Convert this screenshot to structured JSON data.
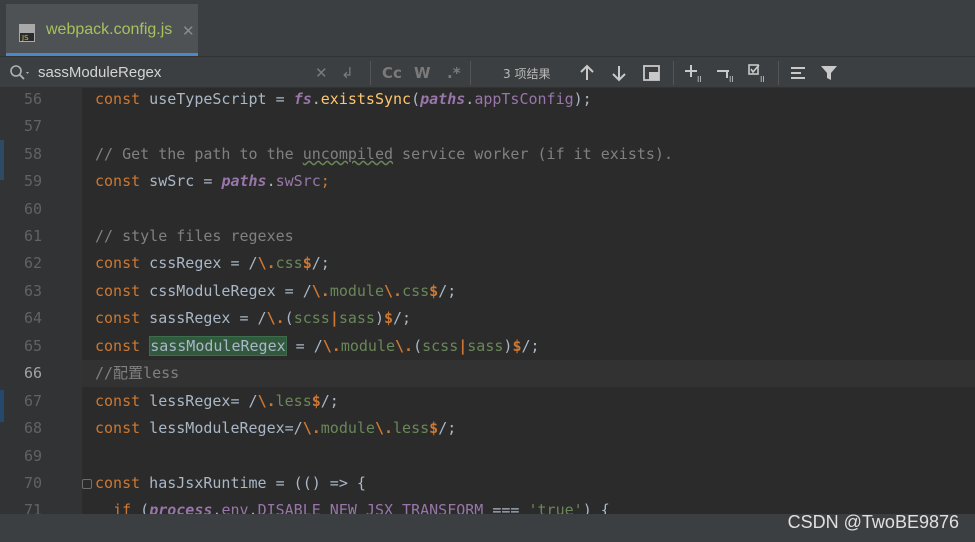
{
  "tab": {
    "filename": "webpack.config.js",
    "icon": "js-file-icon",
    "badge": "JS"
  },
  "search": {
    "value": "sassModuleRegex",
    "match_case_label": "Cc",
    "words_label": "W",
    "regex_label": ".*",
    "match_count": "3 项结果"
  },
  "editor": {
    "lines": [
      {
        "n": "56"
      },
      {
        "n": "57"
      },
      {
        "n": "58"
      },
      {
        "n": "59"
      },
      {
        "n": "60"
      },
      {
        "n": "61"
      },
      {
        "n": "62"
      },
      {
        "n": "63"
      },
      {
        "n": "64"
      },
      {
        "n": "65"
      },
      {
        "n": "66",
        "current": true
      },
      {
        "n": "67"
      },
      {
        "n": "68"
      },
      {
        "n": "69"
      },
      {
        "n": "70"
      },
      {
        "n": "71"
      }
    ],
    "code": {
      "l56": {
        "kw": "const",
        "name": " useTypeScript = ",
        "obj": "fs",
        "dot": ".",
        "fn": "existsSync",
        "open": "(",
        "obj2": "paths",
        "dot2": ".",
        "prop": "appTsConfig",
        "close": ");"
      },
      "l58": {
        "c1": "// Get the path to the ",
        "c2": "uncompiled",
        "c3": " service worker (if it exists)."
      },
      "l59": {
        "kw": "const",
        "name": " swSrc = ",
        "obj": "paths",
        "dot": ".",
        "prop": "swSrc",
        "end": ";"
      },
      "l61": {
        "comment": "// style files regexes"
      },
      "l62": {
        "kw": "const",
        "name": " cssRegex = /",
        "e1": "\\.",
        "r1": "css",
        "e2": "$",
        "end": "/;"
      },
      "l63": {
        "kw": "const",
        "name": " cssModuleRegex = /",
        "e1": "\\.",
        "r1": "module",
        "e2": "\\.",
        "r2": "css",
        "e3": "$",
        "end": "/;"
      },
      "l64": {
        "kw": "const",
        "name": " sassRegex = /",
        "e1": "\\.",
        "p1": "(",
        "r1": "scss",
        "bar": "|",
        "r2": "sass",
        "p2": ")",
        "e2": "$",
        "end": "/;"
      },
      "l65": {
        "kw": "const",
        "sp": " ",
        "match": "sassModuleRegex",
        "name": " = /",
        "e1": "\\.",
        "r1": "module",
        "e2": "\\.",
        "p1": "(",
        "r2": "scss",
        "bar": "|",
        "r3": "sass",
        "p2": ")",
        "e3": "$",
        "end": "/;"
      },
      "l66": {
        "comment": "//配置less"
      },
      "l67": {
        "kw": "const",
        "name": " lessRegex= /",
        "e1": "\\.",
        "r1": "less",
        "e2": "$",
        "end": "/;"
      },
      "l68": {
        "kw": "const",
        "name": " lessModuleRegex=/",
        "e1": "\\.",
        "r1": "module",
        "e2": "\\.",
        "r2": "less",
        "e3": "$",
        "end": "/;"
      },
      "l70": {
        "kw": "const",
        "name": " hasJsxRuntime = (() => {"
      },
      "l71": {
        "indent": "  ",
        "kw": "if",
        "name": " (",
        "obj": "process",
        "dot": ".",
        "prop": "env",
        "dot2": ".",
        "prop2": "DISABLE_NEW_JSX_TRANSFORM",
        "op": " === ",
        "str": "'true'",
        "end": ") {"
      }
    }
  },
  "watermark": "CSDN @TwoBE9876",
  "colors": {
    "keyword": "#cc7832",
    "function": "#ffc66d",
    "property": "#9876aa",
    "regex": "#6a8759",
    "comment": "#808080",
    "match_highlight": "#32593d"
  }
}
